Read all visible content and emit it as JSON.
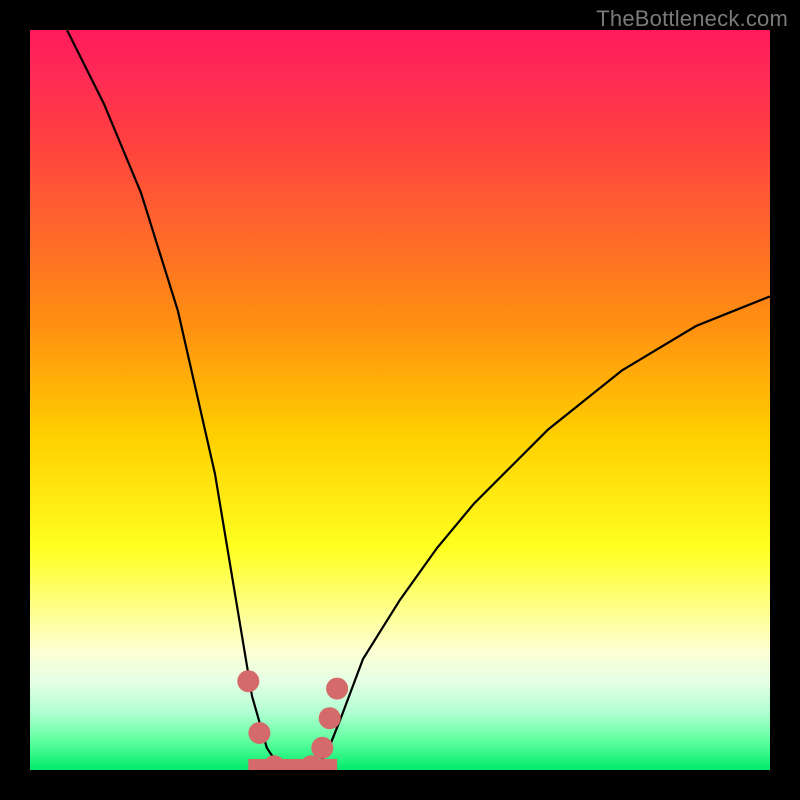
{
  "watermark": "TheBottleneck.com",
  "chart_data": {
    "type": "line",
    "title": "",
    "xlabel": "",
    "ylabel": "",
    "xlim": [
      0,
      100
    ],
    "ylim": [
      0,
      100
    ],
    "series": [
      {
        "name": "bottleneck-curve",
        "x": [
          5,
          10,
          15,
          20,
          25,
          28,
          30,
          32,
          34,
          36,
          38,
          40,
          42,
          45,
          50,
          55,
          60,
          65,
          70,
          75,
          80,
          85,
          90,
          95,
          100
        ],
        "values": [
          100,
          90,
          78,
          62,
          40,
          22,
          10,
          3,
          0,
          0,
          0,
          2,
          7,
          15,
          23,
          30,
          36,
          41,
          46,
          50,
          54,
          57,
          60,
          62,
          64
        ]
      }
    ],
    "highlight": {
      "name": "optimum-markers",
      "x": [
        29.5,
        31,
        33,
        34,
        36,
        38,
        39.5,
        40.5,
        41.5
      ],
      "values": [
        12,
        5,
        0.5,
        0,
        0,
        0.5,
        3,
        7,
        11
      ]
    }
  },
  "colors": {
    "curve": "#000000",
    "markers": "#d46a6a"
  }
}
